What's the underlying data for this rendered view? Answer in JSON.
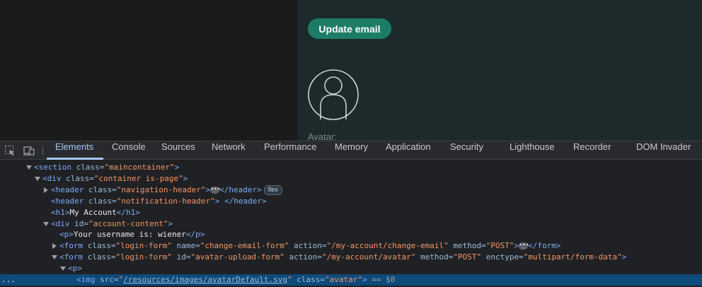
{
  "page": {
    "update_button": "Update email",
    "avatar_label": "Avatar:"
  },
  "devtools": {
    "tabs": [
      "Elements",
      "Console",
      "Sources",
      "Network",
      "Performance",
      "Memory",
      "Application",
      "Security",
      "Lighthouse",
      "Recorder",
      "DOM Invader"
    ],
    "active_tab": "Elements",
    "dom": {
      "l1": {
        "tag": "<section",
        "attr": " class=",
        "val": "\"maincontainer\"",
        "end": ">"
      },
      "l2": {
        "tag": "<div",
        "attr": " class=",
        "val": "\"container is-page\"",
        "end": ">"
      },
      "l3": {
        "tag": "<header",
        "attr": " class=",
        "val": "\"navigation-header\"",
        "end": ">",
        "close": "</header>",
        "badge": "flex"
      },
      "l4": {
        "tag": "<header",
        "attr": " class=",
        "val": "\"notification-header\"",
        "end": ">",
        "close": " </header>"
      },
      "l5": {
        "open": "<h1>",
        "text": "My Account",
        "close": "</h1>"
      },
      "l6": {
        "tag": "<div",
        "attr": " id=",
        "val": "\"account-content\"",
        "end": ">"
      },
      "l7": {
        "open": "<p>",
        "text": "Your username is: wiener",
        "close": "</p>"
      },
      "l8": {
        "tag": "<form",
        "a1": " class=",
        "v1": "\"login-form\"",
        "a2": " name=",
        "v2": "\"change-email-form\"",
        "a3": " action=",
        "v3": "\"/my-account/change-email\"",
        "a4": " method=",
        "v4": "\"POST\"",
        "end": ">",
        "close": "</form>"
      },
      "l9": {
        "tag": "<form",
        "a1": " class=",
        "v1": "\"login-form\"",
        "a2": " id=",
        "v2": "\"avatar-upload-form\"",
        "a3": " action=",
        "v3": "\"/my-account/avatar\"",
        "a4": " method=",
        "v4": "\"POST\"",
        "a5": " enctype=",
        "v5": "\"multipart/form-data\"",
        "end": ">"
      },
      "l10": {
        "open": "<p>"
      },
      "l11": {
        "tag": "<img",
        "a1": " src=",
        "q1": "\"",
        "link": "/resources/images/avatarDefault.svg",
        "q2": "\"",
        "a2": " class=",
        "v2": "\"avatar\"",
        "end": ">",
        "eq": " == $0"
      }
    },
    "ellipsis": "•••",
    "selected_dots": "..."
  },
  "colors": {
    "accent_button": "#1d7c67",
    "selected_row": "#0e4a7a",
    "active_tab": "#a8c7fa"
  }
}
